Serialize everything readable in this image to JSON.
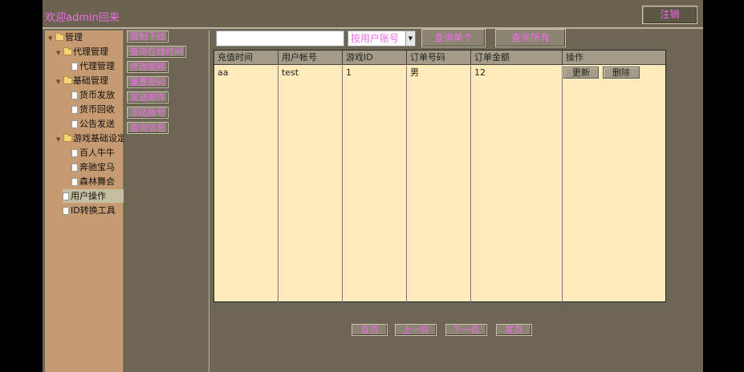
{
  "header": {
    "welcome": "欢迎admin回来",
    "logout_label": "注销"
  },
  "tree": {
    "root": "管理",
    "agent_group": "代理管理",
    "agent_manage": "代理管理",
    "base_group": "基础管理",
    "currency_issue": "货币发放",
    "currency_recover": "货币回收",
    "announcement": "公告发送",
    "game_group": "游戏基础设定",
    "game_1": "百人牛牛",
    "game_2": "奔驰宝马",
    "game_3": "森林舞会",
    "user_ops": "用户操作",
    "id_tool": "ID转换工具"
  },
  "actions": {
    "force_offline": "强制下线",
    "query_online_time": "查询在线时间",
    "edit_nickname": "修改昵称",
    "reset_password": "重置密码",
    "send_mail": "发送邮件",
    "freeze_account": "冻结账号",
    "query_info": "查询信息"
  },
  "search": {
    "input_value": "",
    "select_value": "按用户账号",
    "query_single": "查询单个",
    "query_all": "查询所有"
  },
  "table": {
    "headers": [
      "充值时间",
      "用户帐号",
      "游戏ID",
      "订单号码",
      "订单金额",
      "操作"
    ],
    "rows": [
      {
        "cells": [
          "aa",
          "test",
          "1",
          "男",
          "12"
        ],
        "update": "更新",
        "delete": "删除"
      }
    ]
  },
  "pagination": {
    "first": "首页",
    "prev": "上一页",
    "next": "下一页",
    "last": "尾页"
  },
  "colors": {
    "accent_text": "#f06ce8",
    "frame_bg": "#6e6654",
    "tree_bg": "#c79b71",
    "table_bg": "#ffebb9",
    "table_header_bg": "#a49c88"
  }
}
